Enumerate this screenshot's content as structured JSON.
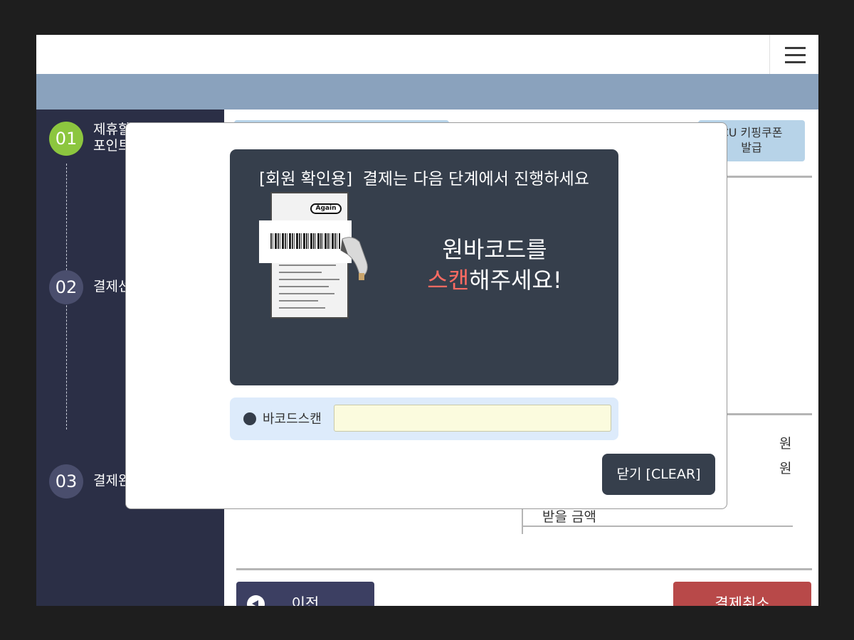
{
  "app": {
    "menu_icon": "hamburger-menu-icon"
  },
  "sidebar": {
    "steps": [
      {
        "number": "01",
        "label": "제휴할인\n포인트",
        "active": true
      },
      {
        "number": "02",
        "label": "결제선택",
        "active": false
      },
      {
        "number": "03",
        "label": "결제완료",
        "active": false
      }
    ]
  },
  "main": {
    "coupon_button_label": "CU 키핑쿠폰\n발급",
    "won_unit_1": "원",
    "won_unit_2": "원",
    "receive_amount_label": "받을 금액",
    "prev_button_label": "이전",
    "cancel_button_label": "결제취소"
  },
  "modal": {
    "title": "[회원 확인용]  결제는 다음 단계에서 진행하세요",
    "receipt_badge": "Again",
    "message_line1": "원바코드를",
    "message_accent": "스캔",
    "message_rest": "해주세요!",
    "barcode_label": "바코드스캔",
    "barcode_value": "",
    "barcode_placeholder": "",
    "close_button_label": "닫기 [CLEAR]"
  },
  "colors": {
    "accent_green": "#8cc63f",
    "sidebar_bg": "#2b2f46",
    "header_band": "#8aa2bd",
    "panel_dark": "#363f4c",
    "accent_red": "#ff6b62",
    "cancel_red": "#b84949",
    "prev_navy": "#3c3f62"
  }
}
